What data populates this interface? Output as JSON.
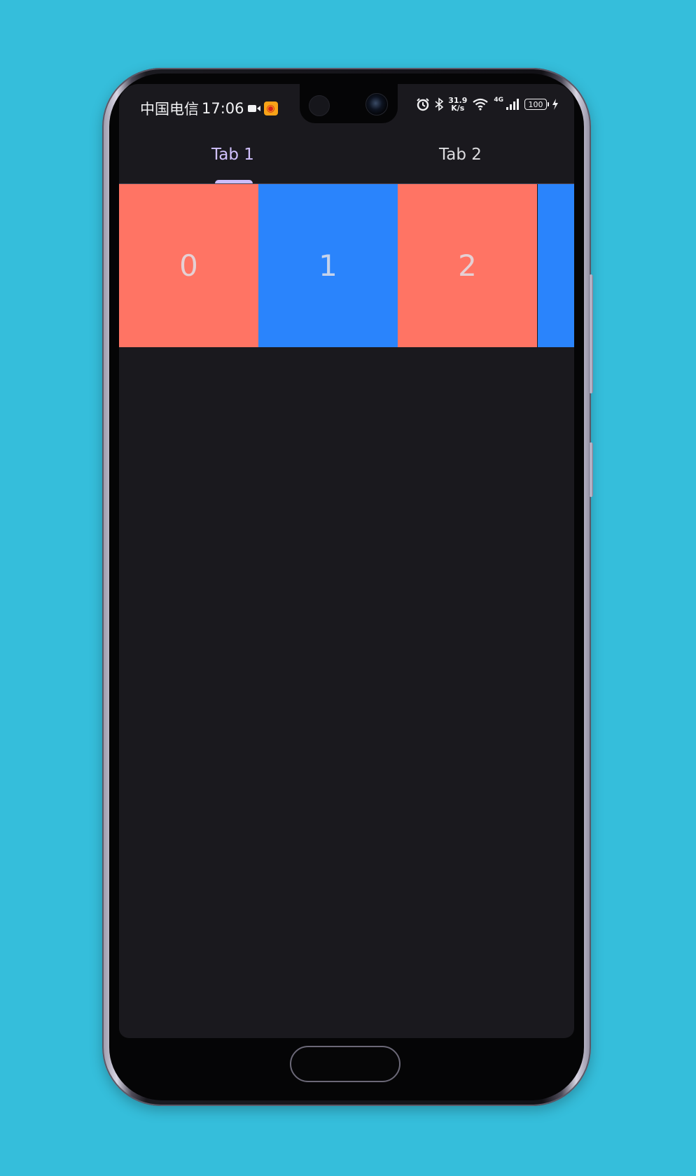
{
  "status_bar": {
    "carrier": "中国电信",
    "time": "17:06",
    "network_speed_value": "31.9",
    "network_speed_unit": "K/s",
    "network_type": "4G",
    "battery_level": "100",
    "icons": [
      "video-camera-icon",
      "weibo-icon",
      "alarm-icon",
      "bluetooth-icon",
      "wifi-icon",
      "signal-icon",
      "battery-icon",
      "charging-icon"
    ]
  },
  "tabs": [
    {
      "label": "Tab 1",
      "selected": true
    },
    {
      "label": "Tab 2",
      "selected": false
    }
  ],
  "carousel": {
    "items": [
      "0",
      "1",
      "2",
      ""
    ],
    "colors": [
      "#ff7464",
      "#2a84fc",
      "#ff7464",
      "#2a84fc"
    ]
  },
  "colors": {
    "background": "#35bedb",
    "screen": "#1a191e",
    "accent": "#cdbdfc"
  }
}
